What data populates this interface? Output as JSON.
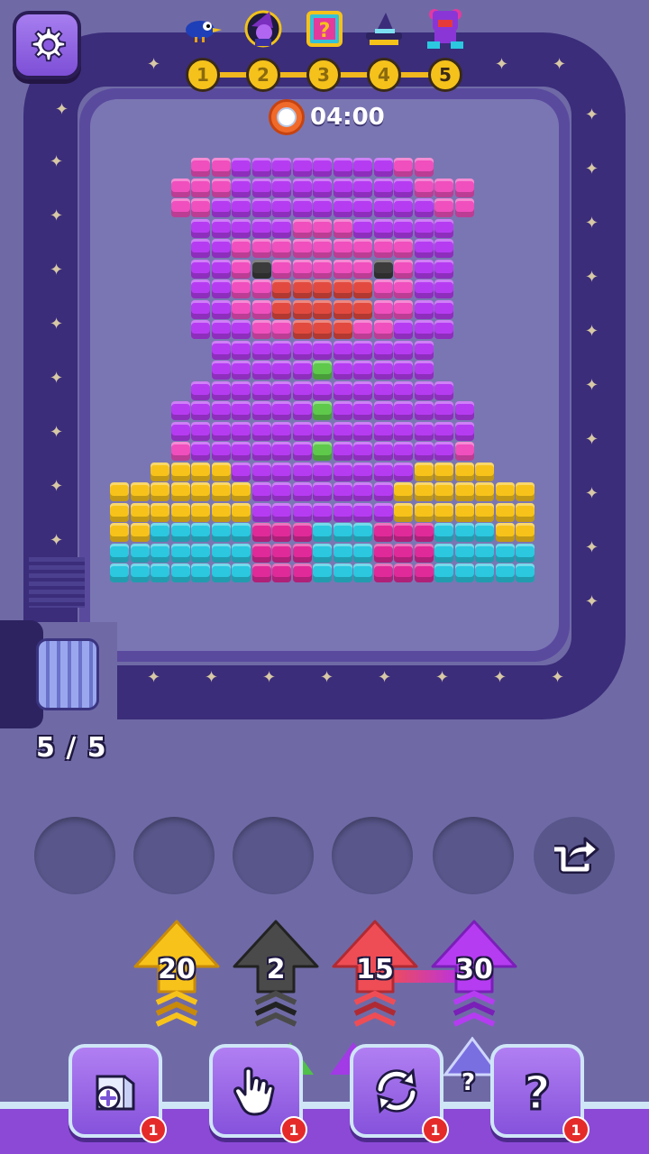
{
  "levels": {
    "items": [
      "1",
      "2",
      "3",
      "4",
      "5"
    ],
    "current": 5
  },
  "rewards": [
    {
      "icon": "bird-icon"
    },
    {
      "icon": "witch-icon"
    },
    {
      "icon": "mystery-box-icon"
    },
    {
      "icon": "witch-hat-icon"
    },
    {
      "icon": "teddy-bear-icon"
    }
  ],
  "timer": {
    "text": "04:00"
  },
  "conveyor": {
    "counter": "5 / 5"
  },
  "colors": {
    "P": "#b63cf2",
    "K": "#f04fbe",
    "R": "#e34a3f",
    "D": "#3c3c3c",
    "G": "#5ec94b",
    "Y": "#f7c31b",
    "C": "#2bc8e0",
    "B": "#e02a9a"
  },
  "pixel_art": {
    "rows": [
      "....KKPPPPPPPPKK.....",
      "...KKKPPPPPPPPPKKK...",
      "...KKPPPPPPPPPPPKK...",
      "....PPPPPKKKPPPPP....",
      "....PPKKKKKKKKKPP....",
      "....PPKDKKKKKDKPP....",
      "....PPKKRRRRRKKPP....",
      "....PPKKRRRRRKKPP....",
      "....PPPKKRRRKKPPP....",
      ".....PPPPPPPPPPP.....",
      ".....PPPPPGPPPPP.....",
      "....PPPPPPPPPPPPP....",
      "...PPPPPPPGPPPPPPP...",
      "...PPPPPPPPPPPPPPP...",
      "...KPPPPPPGPPPPPPK...",
      "..YYYYPPPPPPPPPYYYY..",
      "YYYYYYYPPPPPPPYYYYYYY",
      "YYYYYYYPPPPPPPYYYYYYY",
      "YYCCCCCBBBCCCBBBCCCYY",
      "CCCCCCCBBBCCCBBBCCCCC",
      "CCCCCCCBBBCCCBBBCCCCC"
    ]
  },
  "shooters": [
    {
      "count": "20",
      "color": "#f7c31b",
      "dark": "#c88a0a"
    },
    {
      "count": "2",
      "color": "#4a4a4a",
      "dark": "#222222"
    },
    {
      "count": "15",
      "color": "#ef4d55",
      "dark": "#b02a33"
    },
    {
      "count": "30",
      "color": "#b63cf2",
      "dark": "#7a1fb8"
    }
  ],
  "tools": [
    {
      "icon": "add-slot-icon",
      "badge": "1"
    },
    {
      "icon": "hand-pointer-icon",
      "badge": "1"
    },
    {
      "icon": "refresh-icon",
      "badge": "1"
    },
    {
      "icon": "question-mark-icon",
      "badge": "1"
    }
  ],
  "hidden_shooter": {
    "label": "?"
  }
}
